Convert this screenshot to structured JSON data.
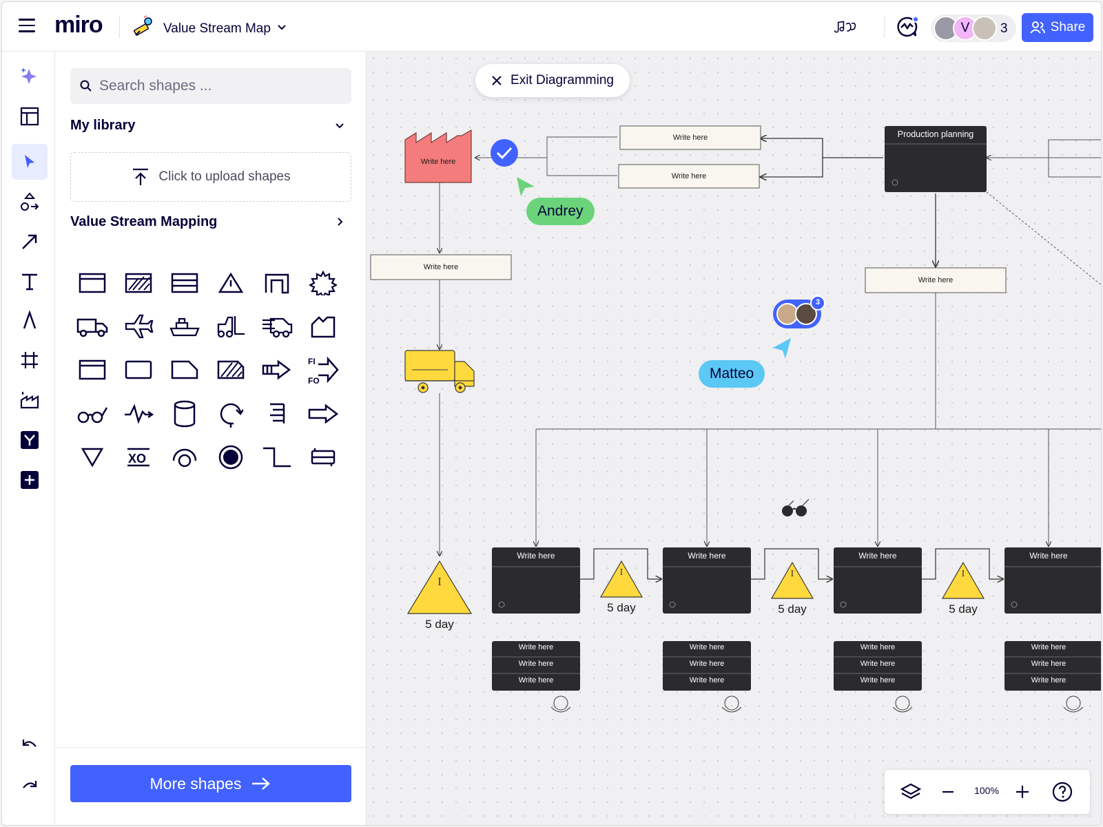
{
  "app": {
    "logo": "miro",
    "board_title": "Value Stream Map",
    "collaborator_count": "3",
    "share_label": "Share",
    "avatar_initial": "V"
  },
  "left_toolbar": {
    "items": [
      "ai-assist",
      "templates",
      "select",
      "shapes",
      "connection-line",
      "text",
      "pen",
      "frame",
      "vsm-chart",
      "custom-app",
      "add-apps"
    ],
    "bottom": [
      "undo",
      "redo"
    ]
  },
  "shapes_panel": {
    "search_placeholder": "Search shapes ...",
    "my_library": "My library",
    "upload_label": "Click to upload shapes",
    "section_title": "Value Stream Mapping",
    "more_shapes": "More shapes",
    "fifo_label": "FI FO",
    "xo_label": "XO"
  },
  "canvas": {
    "exit_label": "Exit Diagramming",
    "supplier_label": "Write here",
    "info_boxes": [
      "Write here",
      "Write here"
    ],
    "production_planning": "Production planning",
    "left_box": "Write here",
    "right_box": "Write here",
    "cursors": [
      {
        "name": "Andrey",
        "color": "#6bd47a"
      },
      {
        "name": "Matteo",
        "color": "#5bc8f5"
      }
    ],
    "comment_count": "3",
    "process_boxes": [
      "Write here",
      "Write here",
      "Write here",
      "Write here"
    ],
    "data_rows": [
      "Write here",
      "Write here",
      "Write here"
    ],
    "inventory_labels": [
      "5 day",
      "5 day",
      "5 day",
      "5 day"
    ],
    "inventory_marker": "I"
  },
  "zoom": {
    "value": "100%"
  },
  "colors": {
    "accent": "#4262ff",
    "dark_box": "#2b2b2e",
    "triangle": "#ffd93d",
    "factory": "#f47c7c",
    "note": "#f8f6ee"
  }
}
